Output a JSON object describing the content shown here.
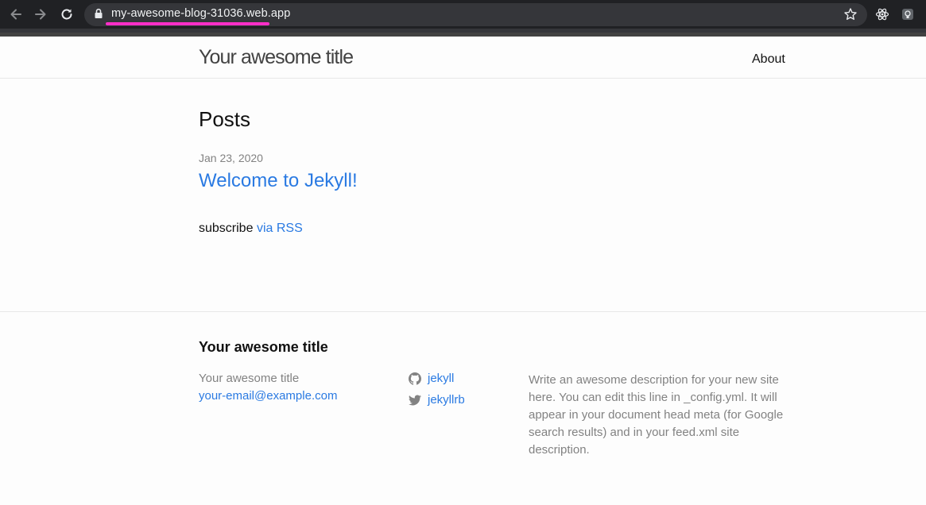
{
  "browser": {
    "url": "my-awesome-blog-31036.web.app",
    "highlight_color": "#ff2ec8"
  },
  "header": {
    "site_title": "Your awesome title",
    "nav": [
      {
        "label": "About"
      }
    ]
  },
  "main": {
    "heading": "Posts",
    "posts": [
      {
        "date": "Jan 23, 2020",
        "title": "Welcome to Jekyll!"
      }
    ],
    "subscribe_text": "subscribe",
    "rss_link": "via RSS"
  },
  "footer": {
    "heading": "Your awesome title",
    "name": "Your awesome title",
    "email": "your-email@example.com",
    "social": [
      {
        "icon": "github-icon",
        "label": "jekyll"
      },
      {
        "icon": "twitter-icon",
        "label": "jekyllrb"
      }
    ],
    "description": "Write an awesome description for your new site here. You can edit this line in _config.yml. It will appear in your document head meta (for Google search results) and in your feed.xml site description."
  },
  "colors": {
    "link": "#2a7ae2",
    "text": "#111111",
    "muted": "#828282",
    "browser_chrome": "#202124"
  }
}
